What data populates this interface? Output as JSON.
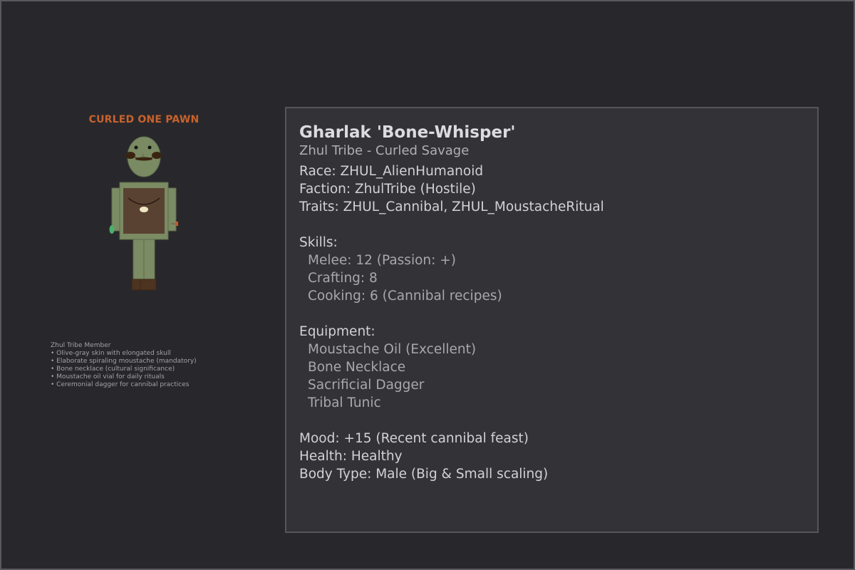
{
  "pawn": {
    "label": "CURLED ONE PAWN",
    "colors": {
      "skin": "#7a8a62",
      "tunic_outer": "#7b8b63",
      "tunic_inner": "#5a4232",
      "moustache": "#3a2410",
      "boots": "#4d3420",
      "vial": "#4caf6a",
      "dagger": "#c85a2a"
    }
  },
  "description": {
    "heading": "Zhul Tribe Member",
    "bullets": [
      "• Olive-gray skin with elongated skull",
      "• Elaborate spiraling moustache (mandatory)",
      "• Bone necklace (cultural significance)",
      "• Moustache oil vial for daily rituals",
      "• Ceremonial dagger for cannibal practices"
    ]
  },
  "info": {
    "name": "Gharlak 'Bone-Whisper'",
    "subtitle": "Zhul Tribe - Curled Savage",
    "race": "Race: ZHUL_AlienHumanoid",
    "faction": "Faction: ZhulTribe (Hostile)",
    "traits": "Traits: ZHUL_Cannibal, ZHUL_MoustacheRitual",
    "skills_heading": "Skills:",
    "skills": [
      "Melee: 12 (Passion: +)",
      "Crafting: 8",
      "Cooking: 6 (Cannibal recipes)"
    ],
    "equipment_heading": "Equipment:",
    "equipment": [
      "Moustache Oil (Excellent)",
      "Bone Necklace",
      "Sacrificial Dagger",
      "Tribal Tunic"
    ],
    "mood": "Mood: +15 (Recent cannibal feast)",
    "health": "Health: Healthy",
    "body_type": "Body Type: Male (Big & Small scaling)"
  }
}
